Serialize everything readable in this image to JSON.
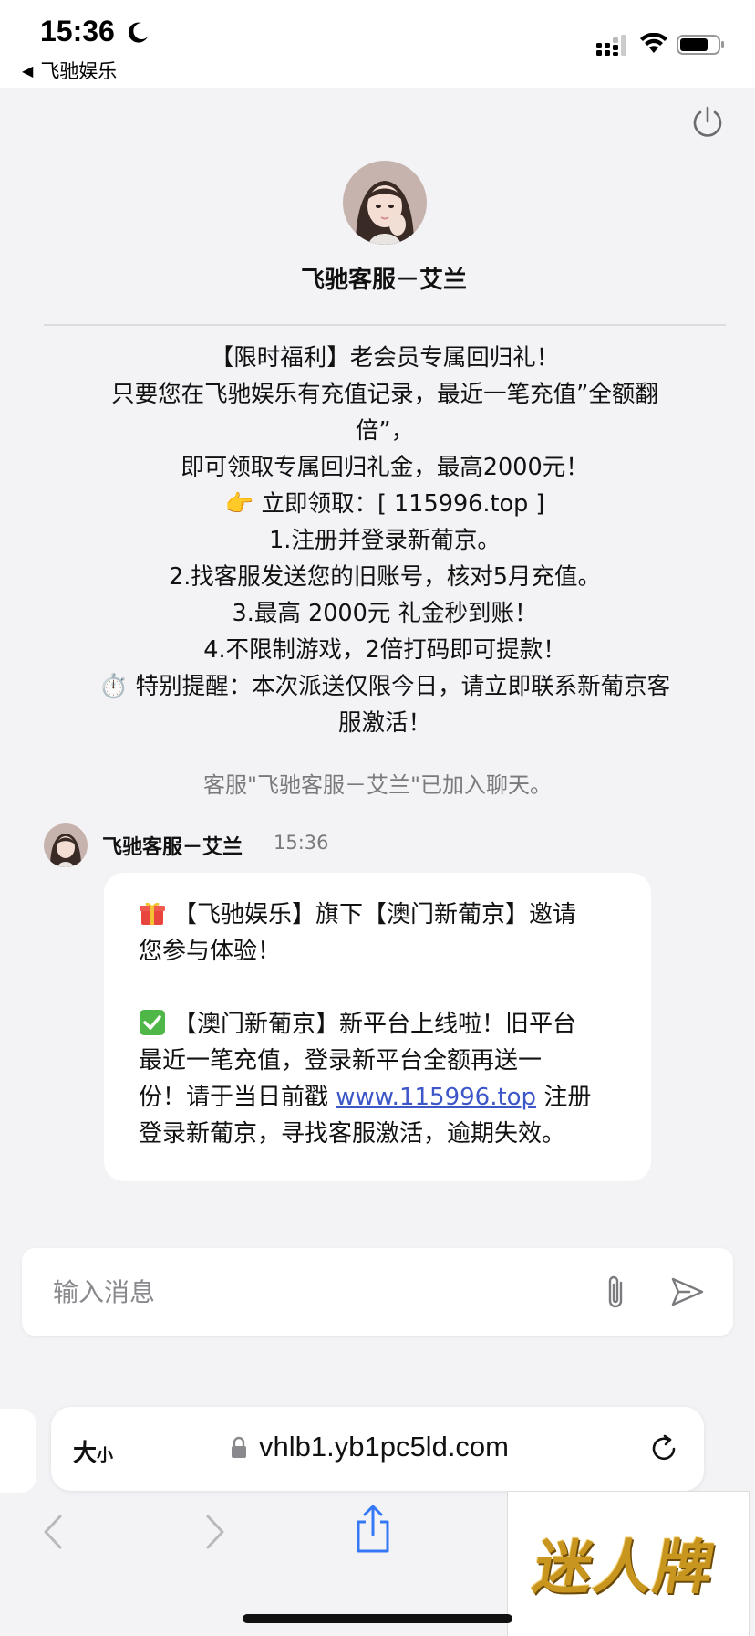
{
  "status_bar": {
    "time": "15:36",
    "back_app": "飞驰娱乐",
    "icons": [
      "moon-icon",
      "signal-icon",
      "wifi-icon",
      "battery-icon"
    ]
  },
  "chat": {
    "agent_name": "飞驰客服－艾兰",
    "welcome_lines": [
      "【限时福利】老会员专属回归礼！",
      "只要您在飞驰娱乐有充值记录，最近一笔充值”全额翻",
      "倍”，",
      "即可领取专属回归礼金，最高2000元！",
      "👉 立即领取：[ 115996.top ]",
      "1.注册并登录新葡京。",
      "2.找客服发送您的旧账号，核对5月充值。",
      "3.最高 2000元 礼金秒到账！",
      "4.不限制游戏，2倍打码即可提款！",
      "⏱️ 特别提醒：本次派送仅限今日，请立即联系新葡京客",
      "服激活！"
    ],
    "system_note": "客服\"飞驰客服－艾兰\"已加入聊天。",
    "message": {
      "sender": "飞驰客服－艾兰",
      "time": "15:36",
      "para1_line1": "【飞驰娱乐】旗下【澳门新葡京】邀请",
      "para1_line2": "您参与体验！",
      "para2_line1": "【澳门新葡京】新平台上线啦！旧平台",
      "para2_line2": "最近一笔充值，登录新平台全额再送一",
      "para2_line3_pre": "份！请于当日前戳 ",
      "para2_link": "www.115996.top",
      "para2_line3_post": " 注册",
      "para2_line4": "登录新葡京，寻找客服激活，逾期失效。"
    }
  },
  "input": {
    "placeholder": "输入消息",
    "value": ""
  },
  "safari": {
    "text_size_big": "大",
    "text_size_small": "小",
    "url": "vhlb1.yb1pc5ld.com"
  },
  "overlay": {
    "brand": "迷人牌"
  },
  "colors": {
    "link": "#3d57c9",
    "background": "#f3f3f6",
    "bubble": "#ffffff",
    "brand_gold": "#c8951e"
  }
}
